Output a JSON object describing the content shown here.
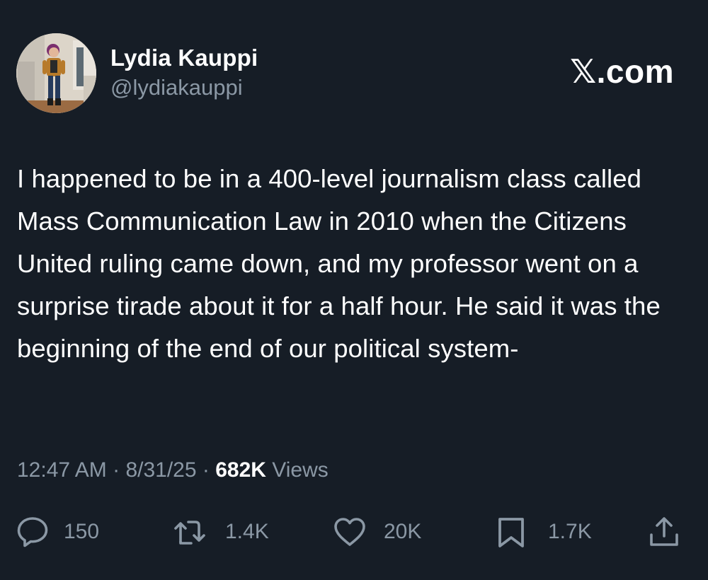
{
  "author": {
    "display_name": "Lydia Kauppi",
    "handle": "@lydiakauppi",
    "avatar": "profile-photo"
  },
  "brand": "𝕏.com",
  "tweet": {
    "text": "I happened to be in a 400-level journalism class called Mass Communication Law in 2010 when the Citizens United ruling came down, and my professor went on a surprise tirade about it for a half hour. He said it was the beginning of the end of our political system-"
  },
  "meta": {
    "time": "12:47 AM",
    "separator": "·",
    "date": "8/31/25",
    "views_count": "682K",
    "views_label": "Views"
  },
  "actions": {
    "reply": {
      "icon": "reply-icon",
      "count": "150"
    },
    "repost": {
      "icon": "repost-icon",
      "count": "1.4K"
    },
    "like": {
      "icon": "heart-icon",
      "count": "20K"
    },
    "bookmark": {
      "icon": "bookmark-icon",
      "count": "1.7K"
    },
    "share": {
      "icon": "share-icon"
    }
  },
  "colors": {
    "background": "#161d26",
    "primary_text": "#ffffff",
    "secondary_text": "#8b98a5"
  }
}
